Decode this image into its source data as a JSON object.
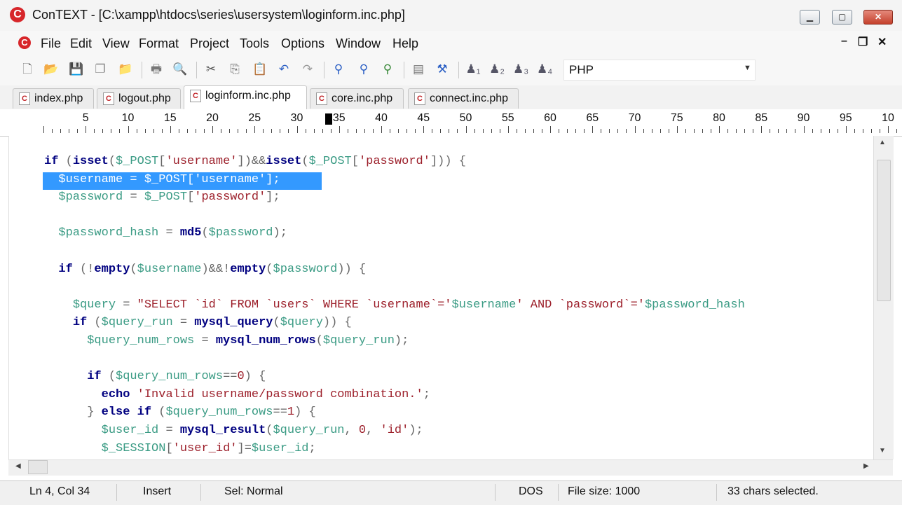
{
  "window": {
    "title": "ConTEXT - [C:\\xampp\\htdocs\\series\\usersystem\\loginform.inc.php]",
    "logo": "C",
    "minimize": "▁",
    "maximize": "▢",
    "close": "✕"
  },
  "menu": {
    "items": [
      "File",
      "Edit",
      "View",
      "Format",
      "Project",
      "Tools",
      "Options",
      "Window",
      "Help"
    ],
    "mdi_minimize": "–",
    "mdi_restore": "❐",
    "mdi_close": "✕"
  },
  "toolbar": {
    "highlighter": "PHP",
    "icons": [
      "new-file-icon",
      "open-folder-icon",
      "save-icon",
      "save-all-icon",
      "open-recent-icon",
      "print-icon",
      "print-preview-icon",
      "cut-icon",
      "copy-icon",
      "paste-icon",
      "undo-icon",
      "redo-icon",
      "find-icon",
      "find-next-icon",
      "replace-icon",
      "file-compare-icon",
      "macro-icon",
      "user-command-1-icon",
      "user-command-2-icon",
      "user-command-3-icon",
      "user-command-4-icon"
    ]
  },
  "tabs": [
    {
      "label": "index.php",
      "active": false
    },
    {
      "label": "logout.php",
      "active": false
    },
    {
      "label": "loginform.inc.php",
      "active": true
    },
    {
      "label": "core.inc.php",
      "active": false
    },
    {
      "label": "connect.inc.php",
      "active": false
    }
  ],
  "ruler": {
    "numbers": [
      "5",
      "10",
      "15",
      "20",
      "25",
      "30",
      "35",
      "40",
      "45",
      "50",
      "55",
      "60",
      "65",
      "70",
      "75",
      "80",
      "85",
      "90",
      "95",
      "10"
    ]
  },
  "code": [
    "if (isset($_POST['username'])&&isset($_POST['password'])) {",
    "  $username = $_POST['username'];",
    "  $password = $_POST['password'];",
    "",
    "  $password_hash = md5($password);",
    "",
    "  if (!empty($username)&&!empty($password)) {",
    "",
    "    $query = \"SELECT `id` FROM `users` WHERE `username`='$username' AND `password`='$password_hash",
    "    if ($query_run = mysql_query($query)) {",
    "      $query_num_rows = mysql_num_rows($query_run);",
    "",
    "      if ($query_num_rows==0) {",
    "        echo 'Invalid username/password combination.';",
    "      } else if ($query_num_rows==1) {",
    "        $user_id = mysql_result($query_run, 0, 'id');",
    "        $_SESSION['user_id']=$user_id;"
  ],
  "status": {
    "position": "Ln 4, Col 34",
    "mode": "Insert",
    "sel": "Sel: Normal",
    "lineend": "DOS",
    "filesize": "File size: 1000",
    "selected": "33 chars selected."
  },
  "colors": {
    "keyword": "#000080",
    "variable": "#3a9b84",
    "string": "#9c1f2a",
    "selection": "#3399ff",
    "logo": "#d7262a"
  }
}
